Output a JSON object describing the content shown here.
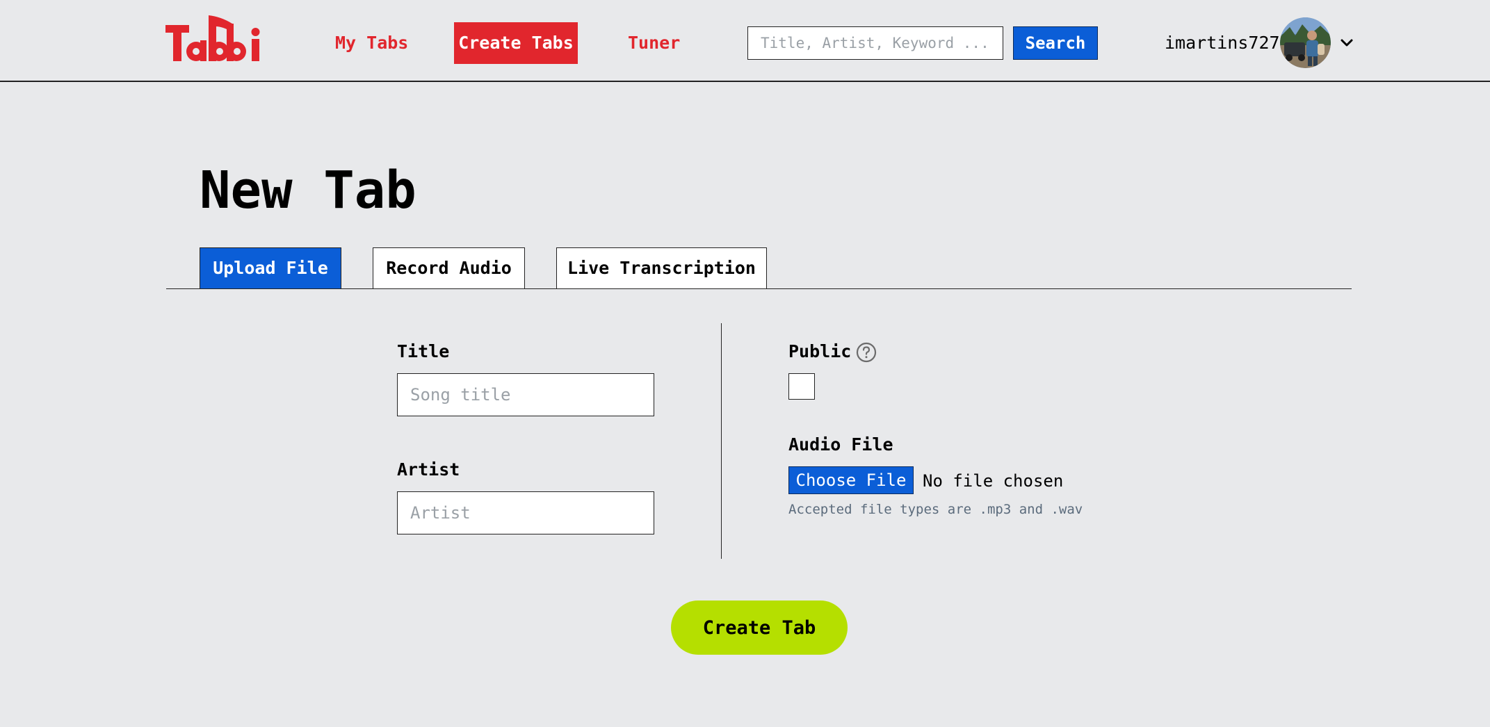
{
  "header": {
    "logo_text": "Tabbi",
    "nav": {
      "my_tabs": "My Tabs",
      "create_tabs": "Create Tabs",
      "tuner": "Tuner"
    },
    "search": {
      "placeholder": "Title, Artist, Keyword ...",
      "value": "",
      "button_label": "Search"
    },
    "user": {
      "username": "imartins727"
    }
  },
  "main": {
    "page_title": "New Tab",
    "tabs": [
      {
        "label": "Upload File",
        "active": true
      },
      {
        "label": "Record Audio",
        "active": false
      },
      {
        "label": "Live Transcription",
        "active": false
      }
    ],
    "form": {
      "title_label": "Title",
      "title_placeholder": "Song title",
      "title_value": "",
      "artist_label": "Artist",
      "artist_placeholder": "Artist",
      "artist_value": "",
      "public_label": "Public",
      "public_checked": false,
      "help_icon": "question-circle-icon",
      "audio_label": "Audio File",
      "choose_file_label": "Choose File",
      "file_status": "No file chosen",
      "accepted_types_hint": "Accepted file types are .mp3 and .wav",
      "submit_label": "Create Tab"
    }
  },
  "colors": {
    "background": "#e8e9eb",
    "brand_red": "#e1262d",
    "primary_blue": "#0b5ed7",
    "submit_green": "#b5df00",
    "hint_gray": "#5b6b7c"
  }
}
